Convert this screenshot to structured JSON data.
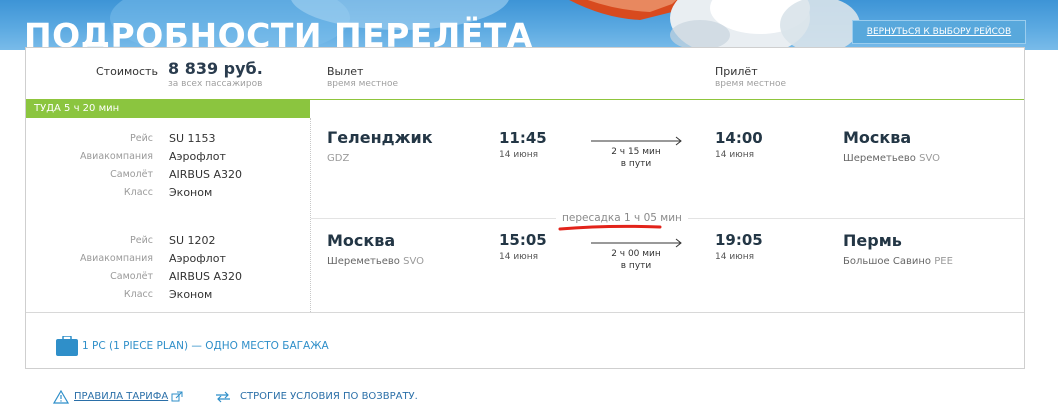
{
  "header": {
    "title": "ПОДРОБНОСТИ ПЕРЕЛЁТА",
    "back_button": "ВЕРНУТЬСЯ К ВЫБОРУ РЕЙСОВ"
  },
  "summary": {
    "cost_label": "Стоимость",
    "cost_value": "8 839 руб.",
    "cost_note": "за всех пассажиров",
    "departure_label": "Вылет",
    "departure_note": "время местное",
    "arrival_label": "Прилёт",
    "arrival_note": "время местное"
  },
  "direction": "ТУДА 5 ч 20 мин",
  "labels": {
    "flight": "Рейс",
    "airline": "Авиакомпания",
    "aircraft": "Самолёт",
    "class": "Класс"
  },
  "segments": [
    {
      "flight_no": "SU 1153",
      "airline": "Аэрофлот",
      "aircraft": "AIRBUS A320",
      "class": "Эконом",
      "from_city": "Геленджик",
      "from_airport": "",
      "from_code": "GDZ",
      "dep_time": "11:45",
      "dep_date": "14 июня",
      "duration": "2 ч 15 мин",
      "in_transit": "в пути",
      "arr_time": "14:00",
      "arr_date": "14 июня",
      "to_city": "Москва",
      "to_airport": "Шереметьево",
      "to_code": "SVO"
    },
    {
      "flight_no": "SU 1202",
      "airline": "Аэрофлот",
      "aircraft": "AIRBUS A320",
      "class": "Эконом",
      "from_city": "Москва",
      "from_airport": "Шереметьево",
      "from_code": "SVO",
      "dep_time": "15:05",
      "dep_date": "14 июня",
      "duration": "2 ч 00 мин",
      "in_transit": "в пути",
      "arr_time": "19:05",
      "arr_date": "14 июня",
      "to_city": "Пермь",
      "to_airport": "Большое Савино",
      "to_code": "PEE"
    }
  ],
  "transfer": "пересадка 1 ч 05 мин",
  "baggage": "1 PC (1 PIECE PLAN) — ОДНО МЕСТО БАГАЖА",
  "footer": {
    "tariff_rules": "ПРАВИЛА ТАРИФА",
    "refund_terms": "СТРОГИЕ УСЛОВИЯ ПО ВОЗВРАТУ."
  },
  "icons": {
    "baggage": "suitcase-icon",
    "warning": "warning-triangle-icon",
    "external": "external-link-icon",
    "exchange": "exchange-arrows-icon"
  },
  "colors": {
    "accent_green": "#8bc53f",
    "banner_blue": "#5ba9e1",
    "link_blue": "#2f8fc9",
    "annotation_red": "#e2231a"
  }
}
